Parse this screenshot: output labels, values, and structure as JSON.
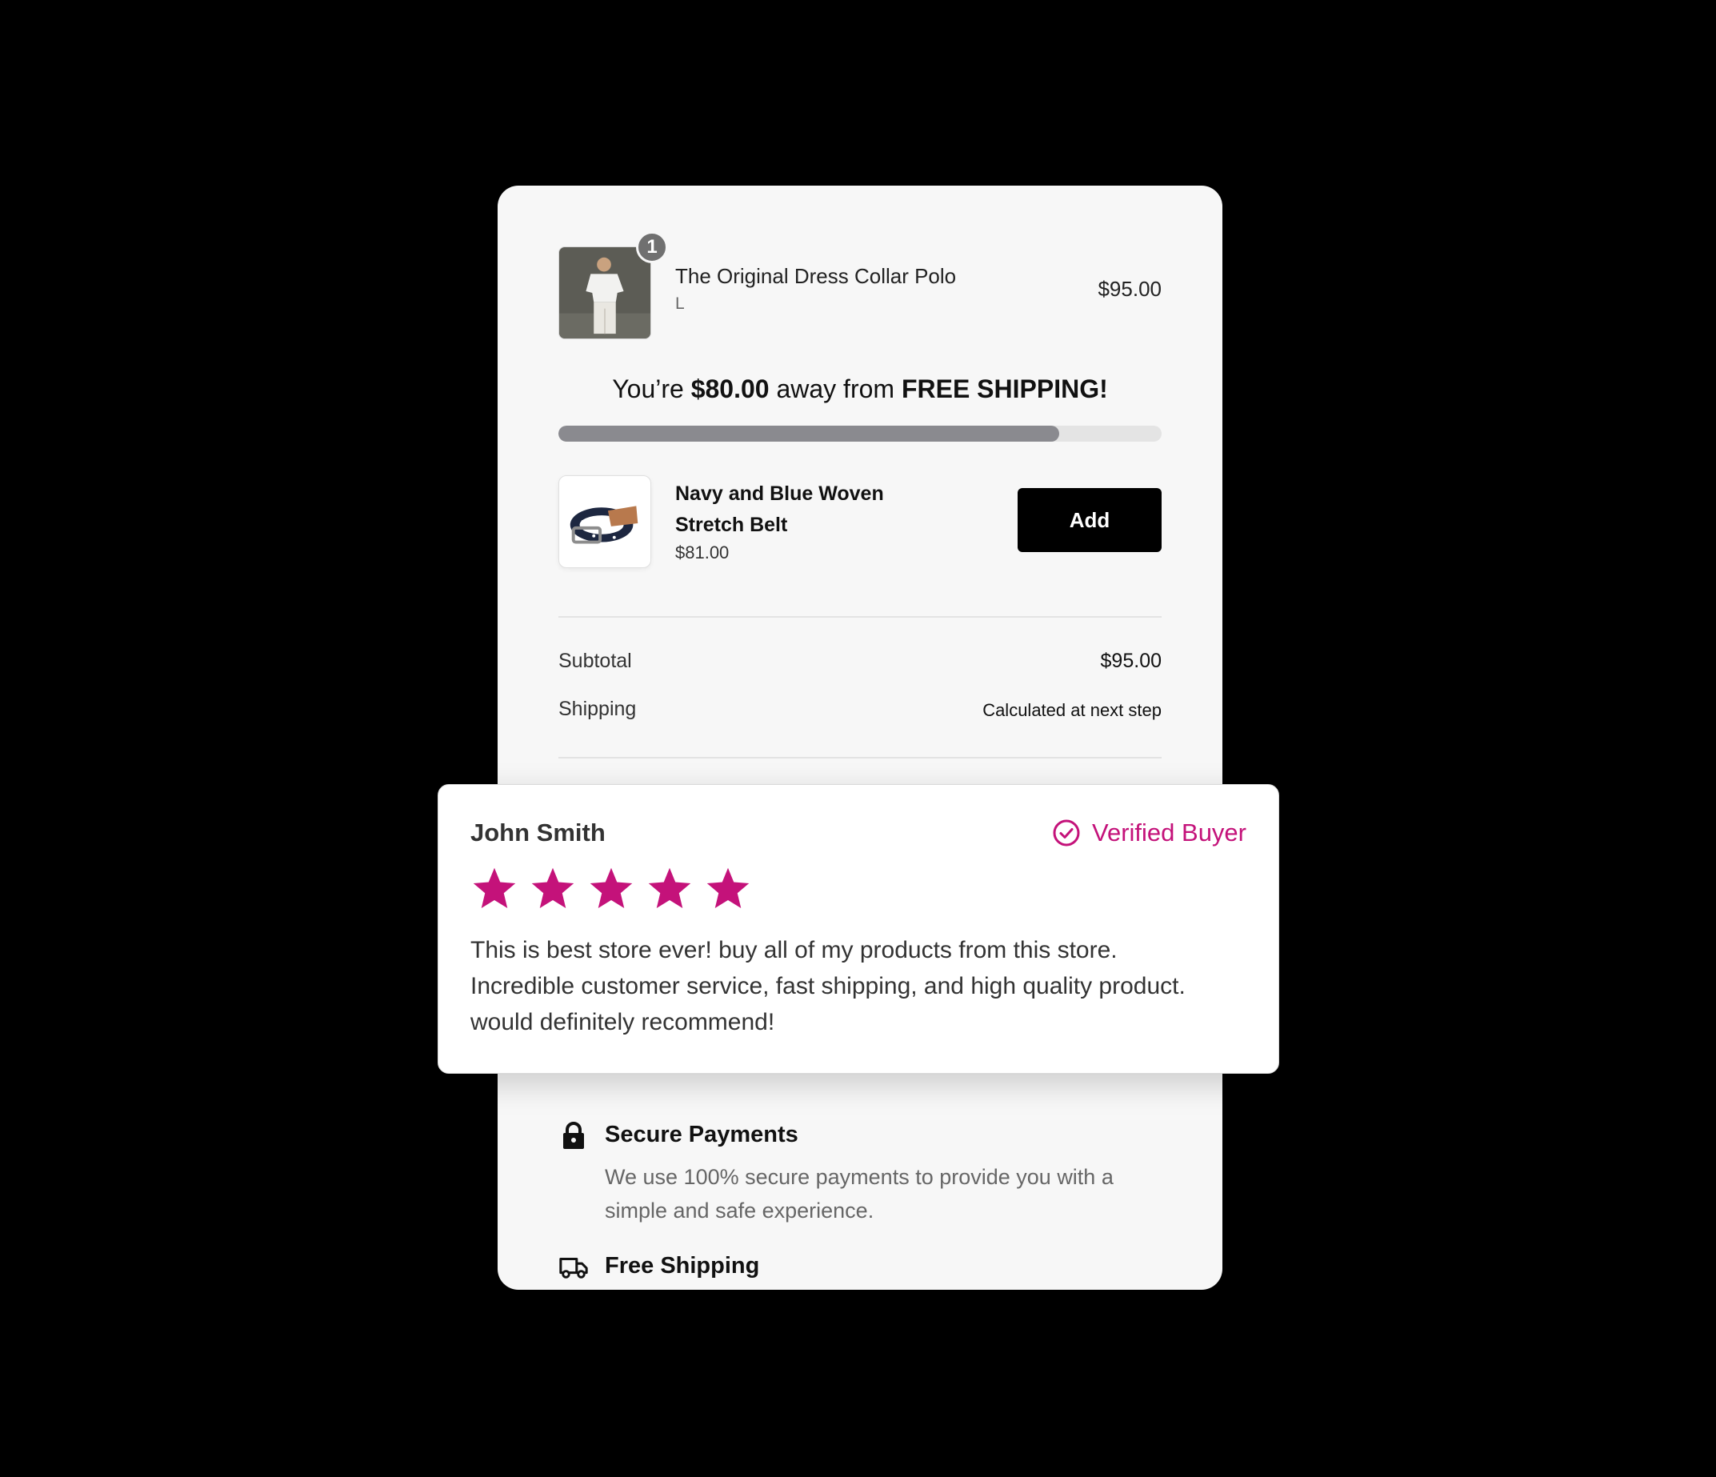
{
  "colors": {
    "background": "#000000",
    "panel": "#f7f7f7",
    "accent": "#c4127a",
    "progress_fill": "#8a8a8f",
    "button": "#000000"
  },
  "cart": {
    "line_item": {
      "name": "The Original Dress Collar Polo",
      "variant": "L",
      "price": "$95.00",
      "quantity": "1"
    },
    "shipping_banner": {
      "prefix": "You’re",
      "amount": "$80.00",
      "middle": "away from",
      "goal": "FREE SHIPPING!",
      "progress_fraction": 0.83
    },
    "upsell": {
      "name": "Navy and Blue Woven Stretch Belt",
      "price": "$81.00",
      "button_label": "Add"
    },
    "summary": {
      "subtotal_label": "Subtotal",
      "subtotal_value": "$95.00",
      "shipping_label": "Shipping",
      "shipping_value": "Calculated at next step"
    },
    "features": [
      {
        "icon": "lock-icon",
        "title": "Secure Payments",
        "description": "We use 100% secure payments to provide you with a simple and safe experience."
      },
      {
        "icon": "truck-icon",
        "title": "Free Shipping"
      }
    ]
  },
  "review": {
    "author": "John Smith",
    "badge": "Verified Buyer",
    "rating": 5,
    "text": "This is best store ever! buy all of my products from this store. Incredible customer service, fast shipping, and high quality product. would definitely recommend!"
  }
}
